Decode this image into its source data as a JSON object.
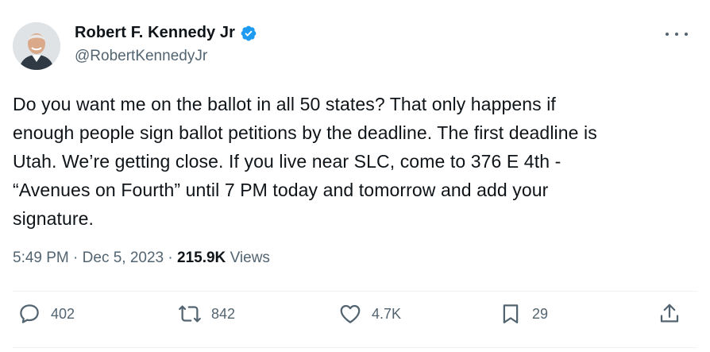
{
  "author": {
    "display_name": "Robert F. Kennedy Jr",
    "handle": "@RobertKennedyJr",
    "verified": true,
    "verified_color": "#1d9bf0"
  },
  "more_icon": "more-horizontal-icon",
  "tweet": {
    "text": "Do you want me on the ballot in all 50 states? That only happens if\nenough people sign ballot petitions by the deadline. The first deadline is\nUtah. We’re getting close. If you live near SLC, come to 376 E 4th -\n“Avenues on Fourth” until 7 PM today and tomorrow and add your\nsignature."
  },
  "meta": {
    "time": "5:49 PM",
    "separator": " · ",
    "date": "Dec 5, 2023",
    "views_count": "215.9K",
    "views_label": " Views"
  },
  "actions": {
    "replies": {
      "icon": "reply-icon",
      "count": "402"
    },
    "reposts": {
      "icon": "repost-icon",
      "count": "842"
    },
    "likes": {
      "icon": "heart-icon",
      "count": "4.7K"
    },
    "bookmarks": {
      "icon": "bookmark-icon",
      "count": "29"
    },
    "share": {
      "icon": "share-icon"
    }
  },
  "colors": {
    "text_primary": "#0f1419",
    "text_secondary": "#536471",
    "divider": "#eff3f4"
  }
}
